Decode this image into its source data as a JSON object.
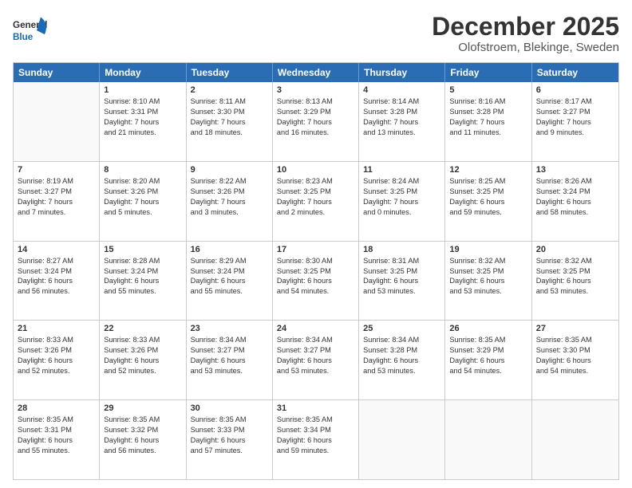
{
  "logo": {
    "general": "General",
    "blue": "Blue"
  },
  "title": "December 2025",
  "location": "Olofstroem, Blekinge, Sweden",
  "headers": [
    "Sunday",
    "Monday",
    "Tuesday",
    "Wednesday",
    "Thursday",
    "Friday",
    "Saturday"
  ],
  "weeks": [
    [
      {
        "day": "",
        "lines": []
      },
      {
        "day": "1",
        "lines": [
          "Sunrise: 8:10 AM",
          "Sunset: 3:31 PM",
          "Daylight: 7 hours",
          "and 21 minutes."
        ]
      },
      {
        "day": "2",
        "lines": [
          "Sunrise: 8:11 AM",
          "Sunset: 3:30 PM",
          "Daylight: 7 hours",
          "and 18 minutes."
        ]
      },
      {
        "day": "3",
        "lines": [
          "Sunrise: 8:13 AM",
          "Sunset: 3:29 PM",
          "Daylight: 7 hours",
          "and 16 minutes."
        ]
      },
      {
        "day": "4",
        "lines": [
          "Sunrise: 8:14 AM",
          "Sunset: 3:28 PM",
          "Daylight: 7 hours",
          "and 13 minutes."
        ]
      },
      {
        "day": "5",
        "lines": [
          "Sunrise: 8:16 AM",
          "Sunset: 3:28 PM",
          "Daylight: 7 hours",
          "and 11 minutes."
        ]
      },
      {
        "day": "6",
        "lines": [
          "Sunrise: 8:17 AM",
          "Sunset: 3:27 PM",
          "Daylight: 7 hours",
          "and 9 minutes."
        ]
      }
    ],
    [
      {
        "day": "7",
        "lines": [
          "Sunrise: 8:19 AM",
          "Sunset: 3:27 PM",
          "Daylight: 7 hours",
          "and 7 minutes."
        ]
      },
      {
        "day": "8",
        "lines": [
          "Sunrise: 8:20 AM",
          "Sunset: 3:26 PM",
          "Daylight: 7 hours",
          "and 5 minutes."
        ]
      },
      {
        "day": "9",
        "lines": [
          "Sunrise: 8:22 AM",
          "Sunset: 3:26 PM",
          "Daylight: 7 hours",
          "and 3 minutes."
        ]
      },
      {
        "day": "10",
        "lines": [
          "Sunrise: 8:23 AM",
          "Sunset: 3:25 PM",
          "Daylight: 7 hours",
          "and 2 minutes."
        ]
      },
      {
        "day": "11",
        "lines": [
          "Sunrise: 8:24 AM",
          "Sunset: 3:25 PM",
          "Daylight: 7 hours",
          "and 0 minutes."
        ]
      },
      {
        "day": "12",
        "lines": [
          "Sunrise: 8:25 AM",
          "Sunset: 3:25 PM",
          "Daylight: 6 hours",
          "and 59 minutes."
        ]
      },
      {
        "day": "13",
        "lines": [
          "Sunrise: 8:26 AM",
          "Sunset: 3:24 PM",
          "Daylight: 6 hours",
          "and 58 minutes."
        ]
      }
    ],
    [
      {
        "day": "14",
        "lines": [
          "Sunrise: 8:27 AM",
          "Sunset: 3:24 PM",
          "Daylight: 6 hours",
          "and 56 minutes."
        ]
      },
      {
        "day": "15",
        "lines": [
          "Sunrise: 8:28 AM",
          "Sunset: 3:24 PM",
          "Daylight: 6 hours",
          "and 55 minutes."
        ]
      },
      {
        "day": "16",
        "lines": [
          "Sunrise: 8:29 AM",
          "Sunset: 3:24 PM",
          "Daylight: 6 hours",
          "and 55 minutes."
        ]
      },
      {
        "day": "17",
        "lines": [
          "Sunrise: 8:30 AM",
          "Sunset: 3:25 PM",
          "Daylight: 6 hours",
          "and 54 minutes."
        ]
      },
      {
        "day": "18",
        "lines": [
          "Sunrise: 8:31 AM",
          "Sunset: 3:25 PM",
          "Daylight: 6 hours",
          "and 53 minutes."
        ]
      },
      {
        "day": "19",
        "lines": [
          "Sunrise: 8:32 AM",
          "Sunset: 3:25 PM",
          "Daylight: 6 hours",
          "and 53 minutes."
        ]
      },
      {
        "day": "20",
        "lines": [
          "Sunrise: 8:32 AM",
          "Sunset: 3:25 PM",
          "Daylight: 6 hours",
          "and 53 minutes."
        ]
      }
    ],
    [
      {
        "day": "21",
        "lines": [
          "Sunrise: 8:33 AM",
          "Sunset: 3:26 PM",
          "Daylight: 6 hours",
          "and 52 minutes."
        ]
      },
      {
        "day": "22",
        "lines": [
          "Sunrise: 8:33 AM",
          "Sunset: 3:26 PM",
          "Daylight: 6 hours",
          "and 52 minutes."
        ]
      },
      {
        "day": "23",
        "lines": [
          "Sunrise: 8:34 AM",
          "Sunset: 3:27 PM",
          "Daylight: 6 hours",
          "and 53 minutes."
        ]
      },
      {
        "day": "24",
        "lines": [
          "Sunrise: 8:34 AM",
          "Sunset: 3:27 PM",
          "Daylight: 6 hours",
          "and 53 minutes."
        ]
      },
      {
        "day": "25",
        "lines": [
          "Sunrise: 8:34 AM",
          "Sunset: 3:28 PM",
          "Daylight: 6 hours",
          "and 53 minutes."
        ]
      },
      {
        "day": "26",
        "lines": [
          "Sunrise: 8:35 AM",
          "Sunset: 3:29 PM",
          "Daylight: 6 hours",
          "and 54 minutes."
        ]
      },
      {
        "day": "27",
        "lines": [
          "Sunrise: 8:35 AM",
          "Sunset: 3:30 PM",
          "Daylight: 6 hours",
          "and 54 minutes."
        ]
      }
    ],
    [
      {
        "day": "28",
        "lines": [
          "Sunrise: 8:35 AM",
          "Sunset: 3:31 PM",
          "Daylight: 6 hours",
          "and 55 minutes."
        ]
      },
      {
        "day": "29",
        "lines": [
          "Sunrise: 8:35 AM",
          "Sunset: 3:32 PM",
          "Daylight: 6 hours",
          "and 56 minutes."
        ]
      },
      {
        "day": "30",
        "lines": [
          "Sunrise: 8:35 AM",
          "Sunset: 3:33 PM",
          "Daylight: 6 hours",
          "and 57 minutes."
        ]
      },
      {
        "day": "31",
        "lines": [
          "Sunrise: 8:35 AM",
          "Sunset: 3:34 PM",
          "Daylight: 6 hours",
          "and 59 minutes."
        ]
      },
      {
        "day": "",
        "lines": []
      },
      {
        "day": "",
        "lines": []
      },
      {
        "day": "",
        "lines": []
      }
    ]
  ]
}
